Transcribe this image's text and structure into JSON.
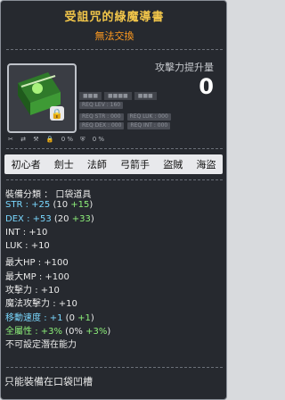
{
  "title": "受詛咒的綠魔導書",
  "subtitle": "無法交換",
  "attack_increase": {
    "label": "攻擊力提升量",
    "value": "0"
  },
  "requirements": {
    "level": "REQ LEV : 160",
    "str": "REQ STR : 000",
    "luk": "REQ LUK : 000",
    "dex": "REQ DEX : 000",
    "int": "REQ INT : 000"
  },
  "percent_icons": [
    "0 %",
    "0 %"
  ],
  "jobs": [
    "初心者",
    "劍士",
    "法師",
    "弓箭手",
    "盜賊",
    "海盜"
  ],
  "stats": [
    {
      "label": "裝備分類 ： 口袋道具",
      "color": "white"
    },
    {
      "label": "STR",
      "base": ": +25",
      "extra": "(10 ",
      "bonus": "+15",
      "close": ")",
      "color": "cyan"
    },
    {
      "label": "DEX",
      "base": ": +53",
      "extra": "(20 ",
      "bonus": "+33",
      "close": ")",
      "color": "cyan"
    },
    {
      "label": "INT",
      "base": ": +10",
      "color": "white"
    },
    {
      "label": "LUK",
      "base": ": +10",
      "color": "white"
    },
    {
      "label": "最大HP",
      "base": ": +100",
      "color": "white"
    },
    {
      "label": "最大MP",
      "base": ": +100",
      "color": "white"
    },
    {
      "label": "攻擊力",
      "base": ": +10",
      "color": "white"
    },
    {
      "label": "魔法攻擊力",
      "base": ": +10",
      "color": "white"
    },
    {
      "label": "移動速度",
      "base": ": +1",
      "extra": "(0 ",
      "bonus": "+1",
      "close": ")",
      "color": "cyan"
    },
    {
      "label": "全屬性",
      "base": ": +3%",
      "extra": "(0% ",
      "bonus": "+3%",
      "close": ")",
      "color": "green"
    },
    {
      "label": "不可設定潛在能力",
      "color": "white"
    }
  ],
  "footer": "只能裝備在口袋凹槽",
  "colors": {
    "title": "#f2c64a",
    "subtitle": "#ff9a1f",
    "cyan": "#7ad8ff",
    "green": "#8df07a"
  }
}
